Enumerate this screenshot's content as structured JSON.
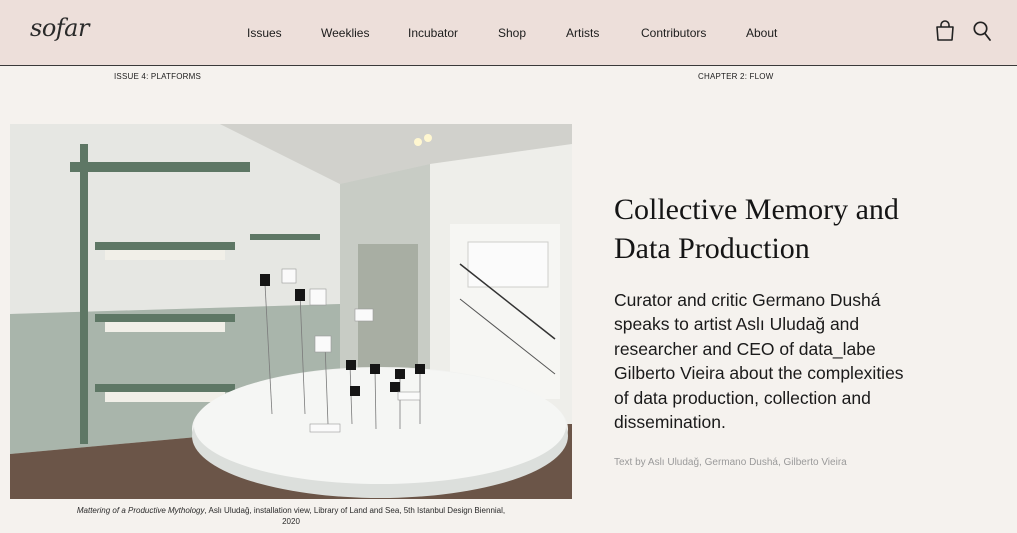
{
  "nav": {
    "logo": "sofar",
    "items": [
      "Issues",
      "Weeklies",
      "Incubator",
      "Shop",
      "Artists",
      "Contributors",
      "About"
    ],
    "icons": [
      "bag-icon",
      "search-icon"
    ]
  },
  "breadcrumbs": {
    "issue": "ISSUE 4: PLATFORMS",
    "chapter": "CHAPTER 2: FLOW"
  },
  "article": {
    "title": "Collective Memory and Data Production",
    "standfirst": "Curator and critic Germano Dushá speaks to artist Aslı Uludağ and researcher and CEO of data_labe Gilberto Vieira about the complexities of data production, collection and dissemination.",
    "byline": "Text by Aslı Uludağ, Germano Dushá, Gilberto Vieira"
  },
  "image": {
    "caption_title": "Mattering of a Productive Mythology",
    "caption_rest": ", Aslı Uludağ, installation view, Library of Land and Sea, 5th Istanbul Design Biennial, 2020"
  },
  "colors": {
    "header_bg": "#eddfda",
    "page_bg": "#f5f2ee",
    "text": "#1c1c1c",
    "byline": "#9a9a9a"
  }
}
